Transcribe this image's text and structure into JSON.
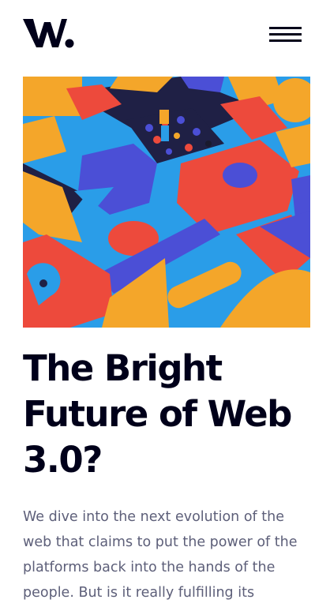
{
  "header": {
    "logo_icon": "w-logo-icon",
    "menu_icon": "hamburger-menu-icon"
  },
  "hero": {
    "image": "abstract 3D colorful blocks illustration",
    "colors": {
      "orange": "#f4a62a",
      "red": "#ed4a3c",
      "blue": "#4b4fd6",
      "cyan": "#2a9de8",
      "navy": "#1f2045"
    }
  },
  "article": {
    "title": "The Bright Future of Web 3.0?",
    "description": "We dive into the next evolution of the web that claims to put the power of the platforms back into the hands of the people. But is it really fulfilling its"
  }
}
